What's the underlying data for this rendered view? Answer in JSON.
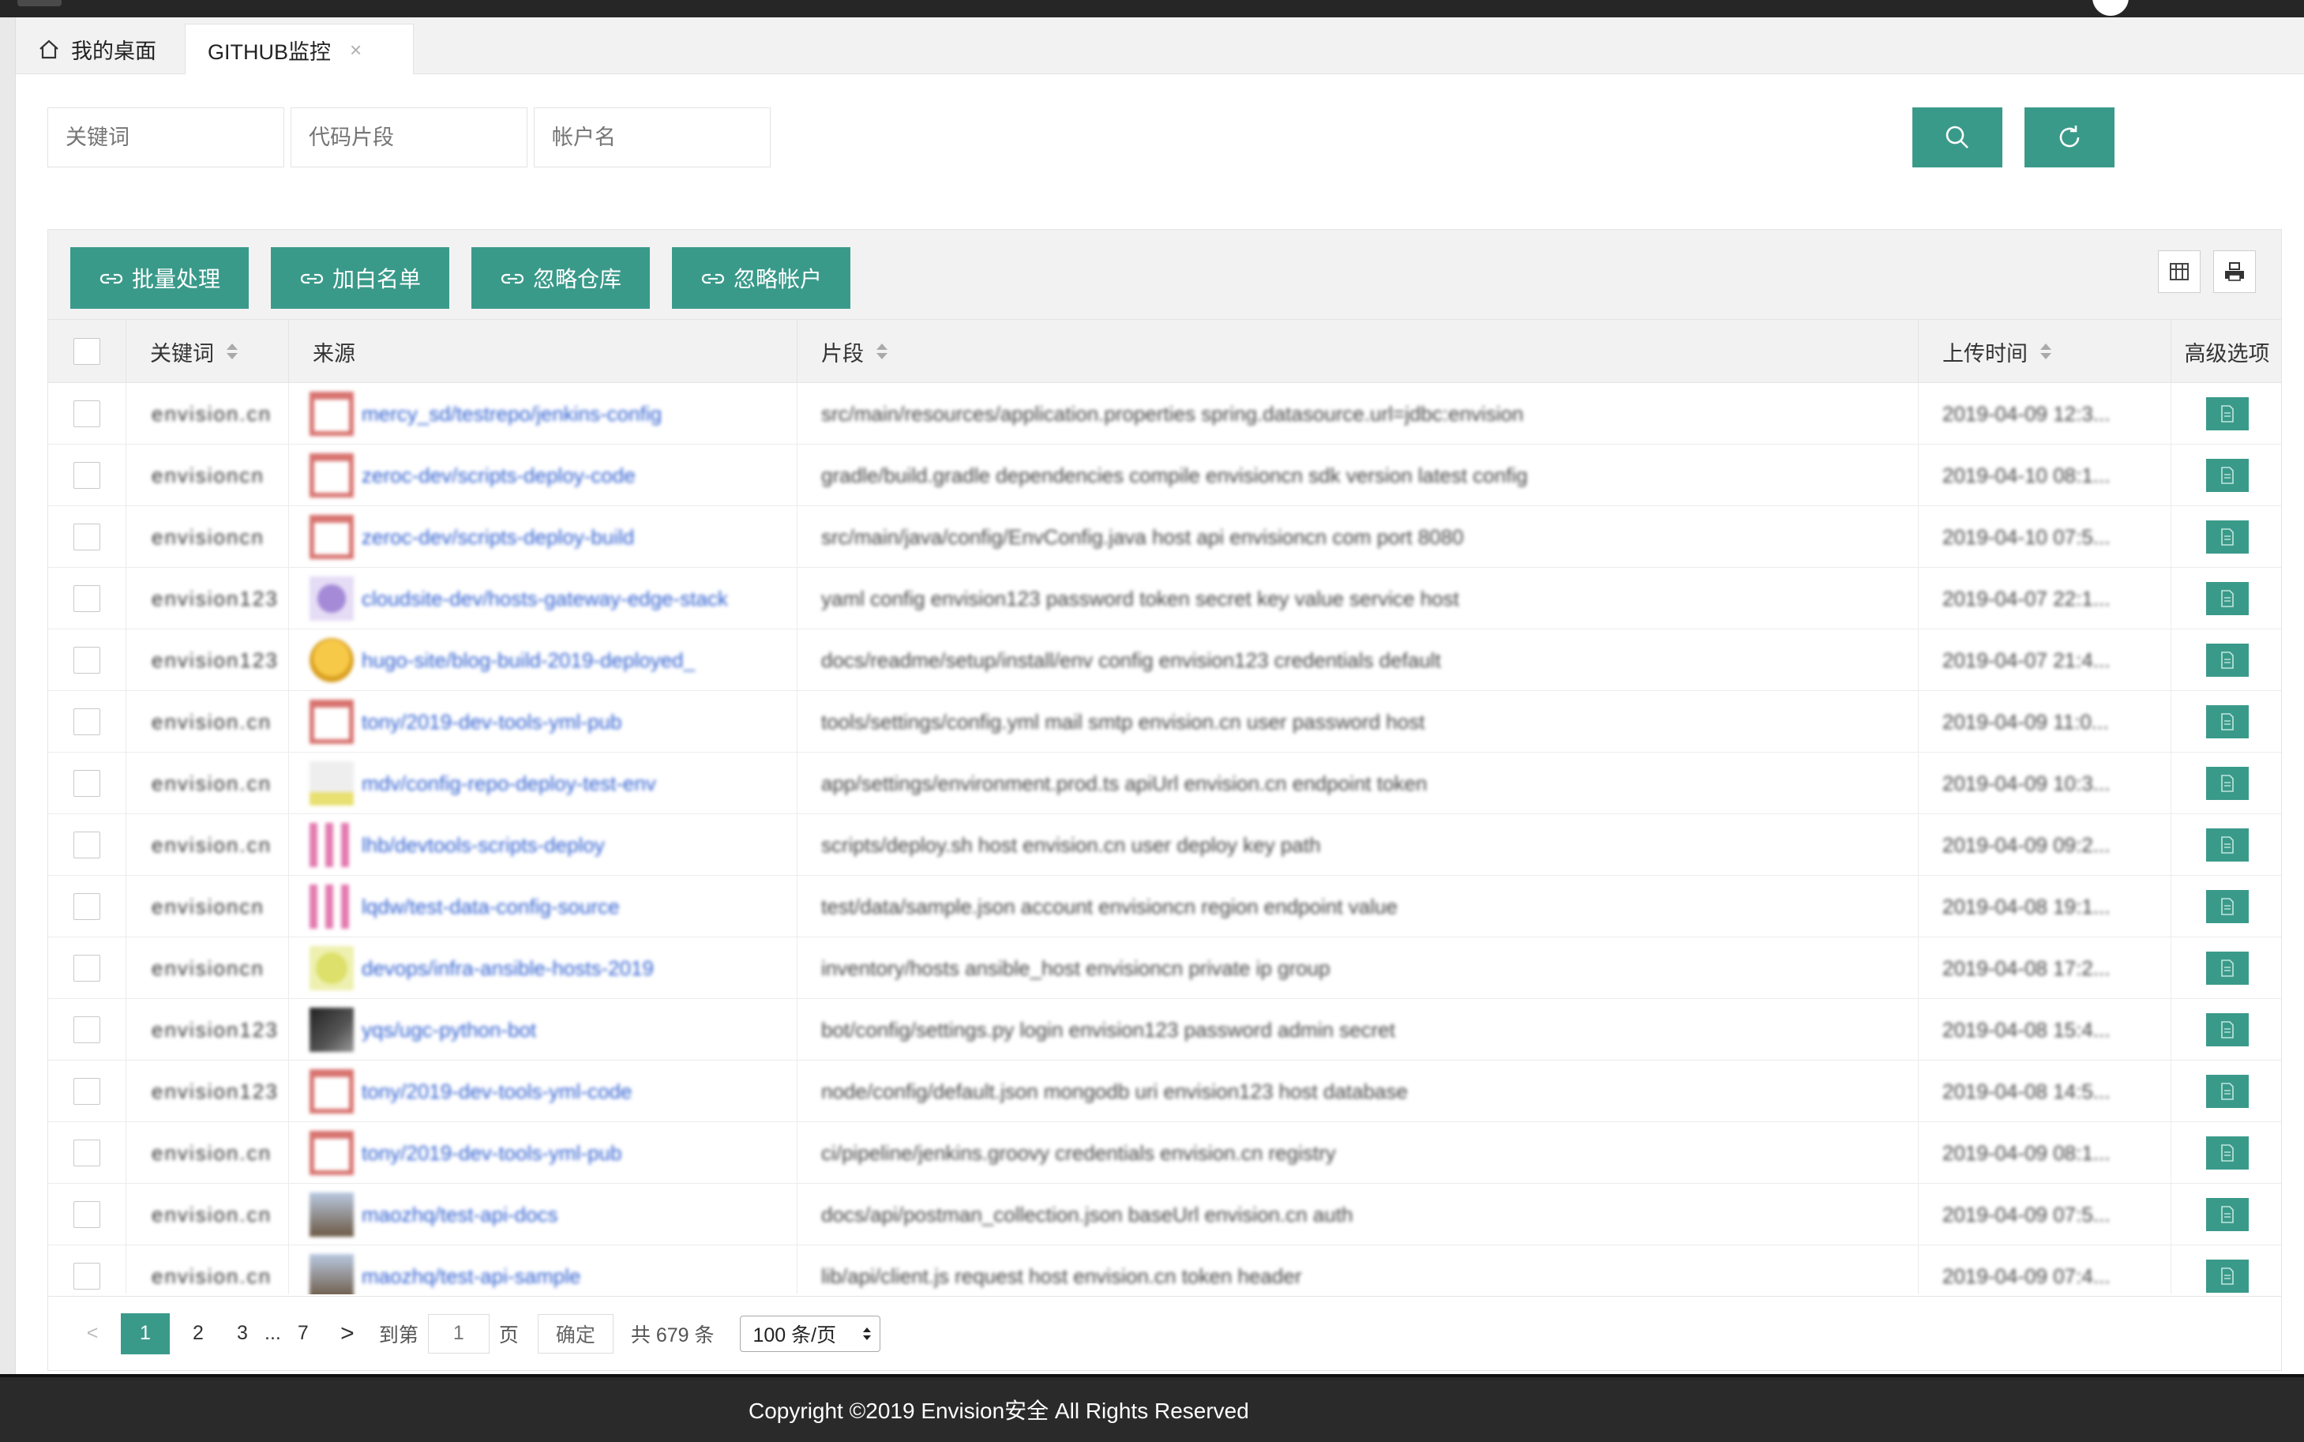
{
  "tabs": [
    {
      "label": "我的桌面",
      "icon": "home-icon"
    },
    {
      "label": "GITHUB监控",
      "close": "×"
    }
  ],
  "search": {
    "keyword_placeholder": "关键词",
    "snippet_placeholder": "代码片段",
    "account_placeholder": "帐户名",
    "search_icon": "search-icon",
    "refresh_icon": "refresh-icon"
  },
  "toolbar": {
    "batch": "批量处理",
    "whitelist": "加白名单",
    "ignore_repo": "忽略仓库",
    "ignore_account": "忽略帐户"
  },
  "columns": {
    "keyword": "关键词",
    "source": "来源",
    "fragment": "片段",
    "upload_time": "上传时间",
    "advanced": "高级选项"
  },
  "rows": [
    {
      "kw": "envision.cn",
      "src": "mercy_sd/testrepo/jenkins-config",
      "frag": "src/main/resources/application.properties spring.datasource.url=jdbc:envision",
      "time": "2019-04-09 12:3..."
    },
    {
      "kw": "envisioncn",
      "src": "zeroc-dev/scripts-deploy-code",
      "frag": "gradle/build.gradle dependencies compile envisioncn sdk version latest config",
      "time": "2019-04-10 08:1..."
    },
    {
      "kw": "envisioncn",
      "src": "zeroc-dev/scripts-deploy-build",
      "frag": "src/main/java/config/EnvConfig.java host api envisioncn com port 8080",
      "time": "2019-04-10 07:5..."
    },
    {
      "kw": "envision123",
      "src": "cloudsite-dev/hosts-gateway-edge-stack",
      "frag": "yaml config envision123 password token secret key value service host",
      "time": "2019-04-07 22:1..."
    },
    {
      "kw": "envision123",
      "src": "hugo-site/blog-build-2019-deployed_",
      "frag": "docs/readme/setup/install/env config envision123 credentials default",
      "time": "2019-04-07 21:4..."
    },
    {
      "kw": "envision.cn",
      "src": "tony/2019-dev-tools-yml-pub",
      "frag": "tools/settings/config.yml mail smtp envision.cn user password host",
      "time": "2019-04-09 11:0..."
    },
    {
      "kw": "envision.cn",
      "src": "mdv/config-repo-deploy-test-env",
      "frag": "app/settings/environment.prod.ts apiUrl envision.cn endpoint token",
      "time": "2019-04-09 10:3..."
    },
    {
      "kw": "envision.cn",
      "src": "lhb/devtools-scripts-deploy",
      "frag": "scripts/deploy.sh host envision.cn user deploy key path",
      "time": "2019-04-09 09:2..."
    },
    {
      "kw": "envisioncn",
      "src": "lqdw/test-data-config-source",
      "frag": "test/data/sample.json account envisioncn region endpoint value",
      "time": "2019-04-08 19:1..."
    },
    {
      "kw": "envisioncn",
      "src": "devops/infra-ansible-hosts-2019",
      "frag": "inventory/hosts ansible_host envisioncn private ip group",
      "time": "2019-04-08 17:2..."
    },
    {
      "kw": "envision123",
      "src": "yqs/ugc-python-bot",
      "frag": "bot/config/settings.py login envision123 password admin secret",
      "time": "2019-04-08 15:4..."
    },
    {
      "kw": "envision123",
      "src": "tony/2019-dev-tools-yml-code",
      "frag": "node/config/default.json mongodb uri envision123 host database",
      "time": "2019-04-08 14:5..."
    },
    {
      "kw": "envision.cn",
      "src": "tony/2019-dev-tools-yml-pub",
      "frag": "ci/pipeline/jenkins.groovy credentials envision.cn registry",
      "time": "2019-04-09 08:1..."
    },
    {
      "kw": "envision.cn",
      "src": "maozhq/test-api-docs",
      "frag": "docs/api/postman_collection.json baseUrl envision.cn auth",
      "time": "2019-04-09 07:5..."
    },
    {
      "kw": "envision.cn",
      "src": "maozhq/test-api-sample",
      "frag": "lib/api/client.js request host envision.cn token header",
      "time": "2019-04-09 07:4..."
    }
  ],
  "pagination": {
    "prev": "<",
    "pages": [
      "1",
      "2",
      "3"
    ],
    "ellipsis": "...",
    "last": "7",
    "next": ">",
    "goto_label": "到第",
    "goto_value": "1",
    "page_suffix": "页",
    "confirm": "确定",
    "total": "共 679 条",
    "page_size": "100 条/页"
  },
  "footer": "Copyright ©2019 Envision安全 All Rights Reserved",
  "colors": {
    "accent": "#3a9a8a",
    "link": "#2f5fd0",
    "footer_bg": "#2a2a2a"
  }
}
